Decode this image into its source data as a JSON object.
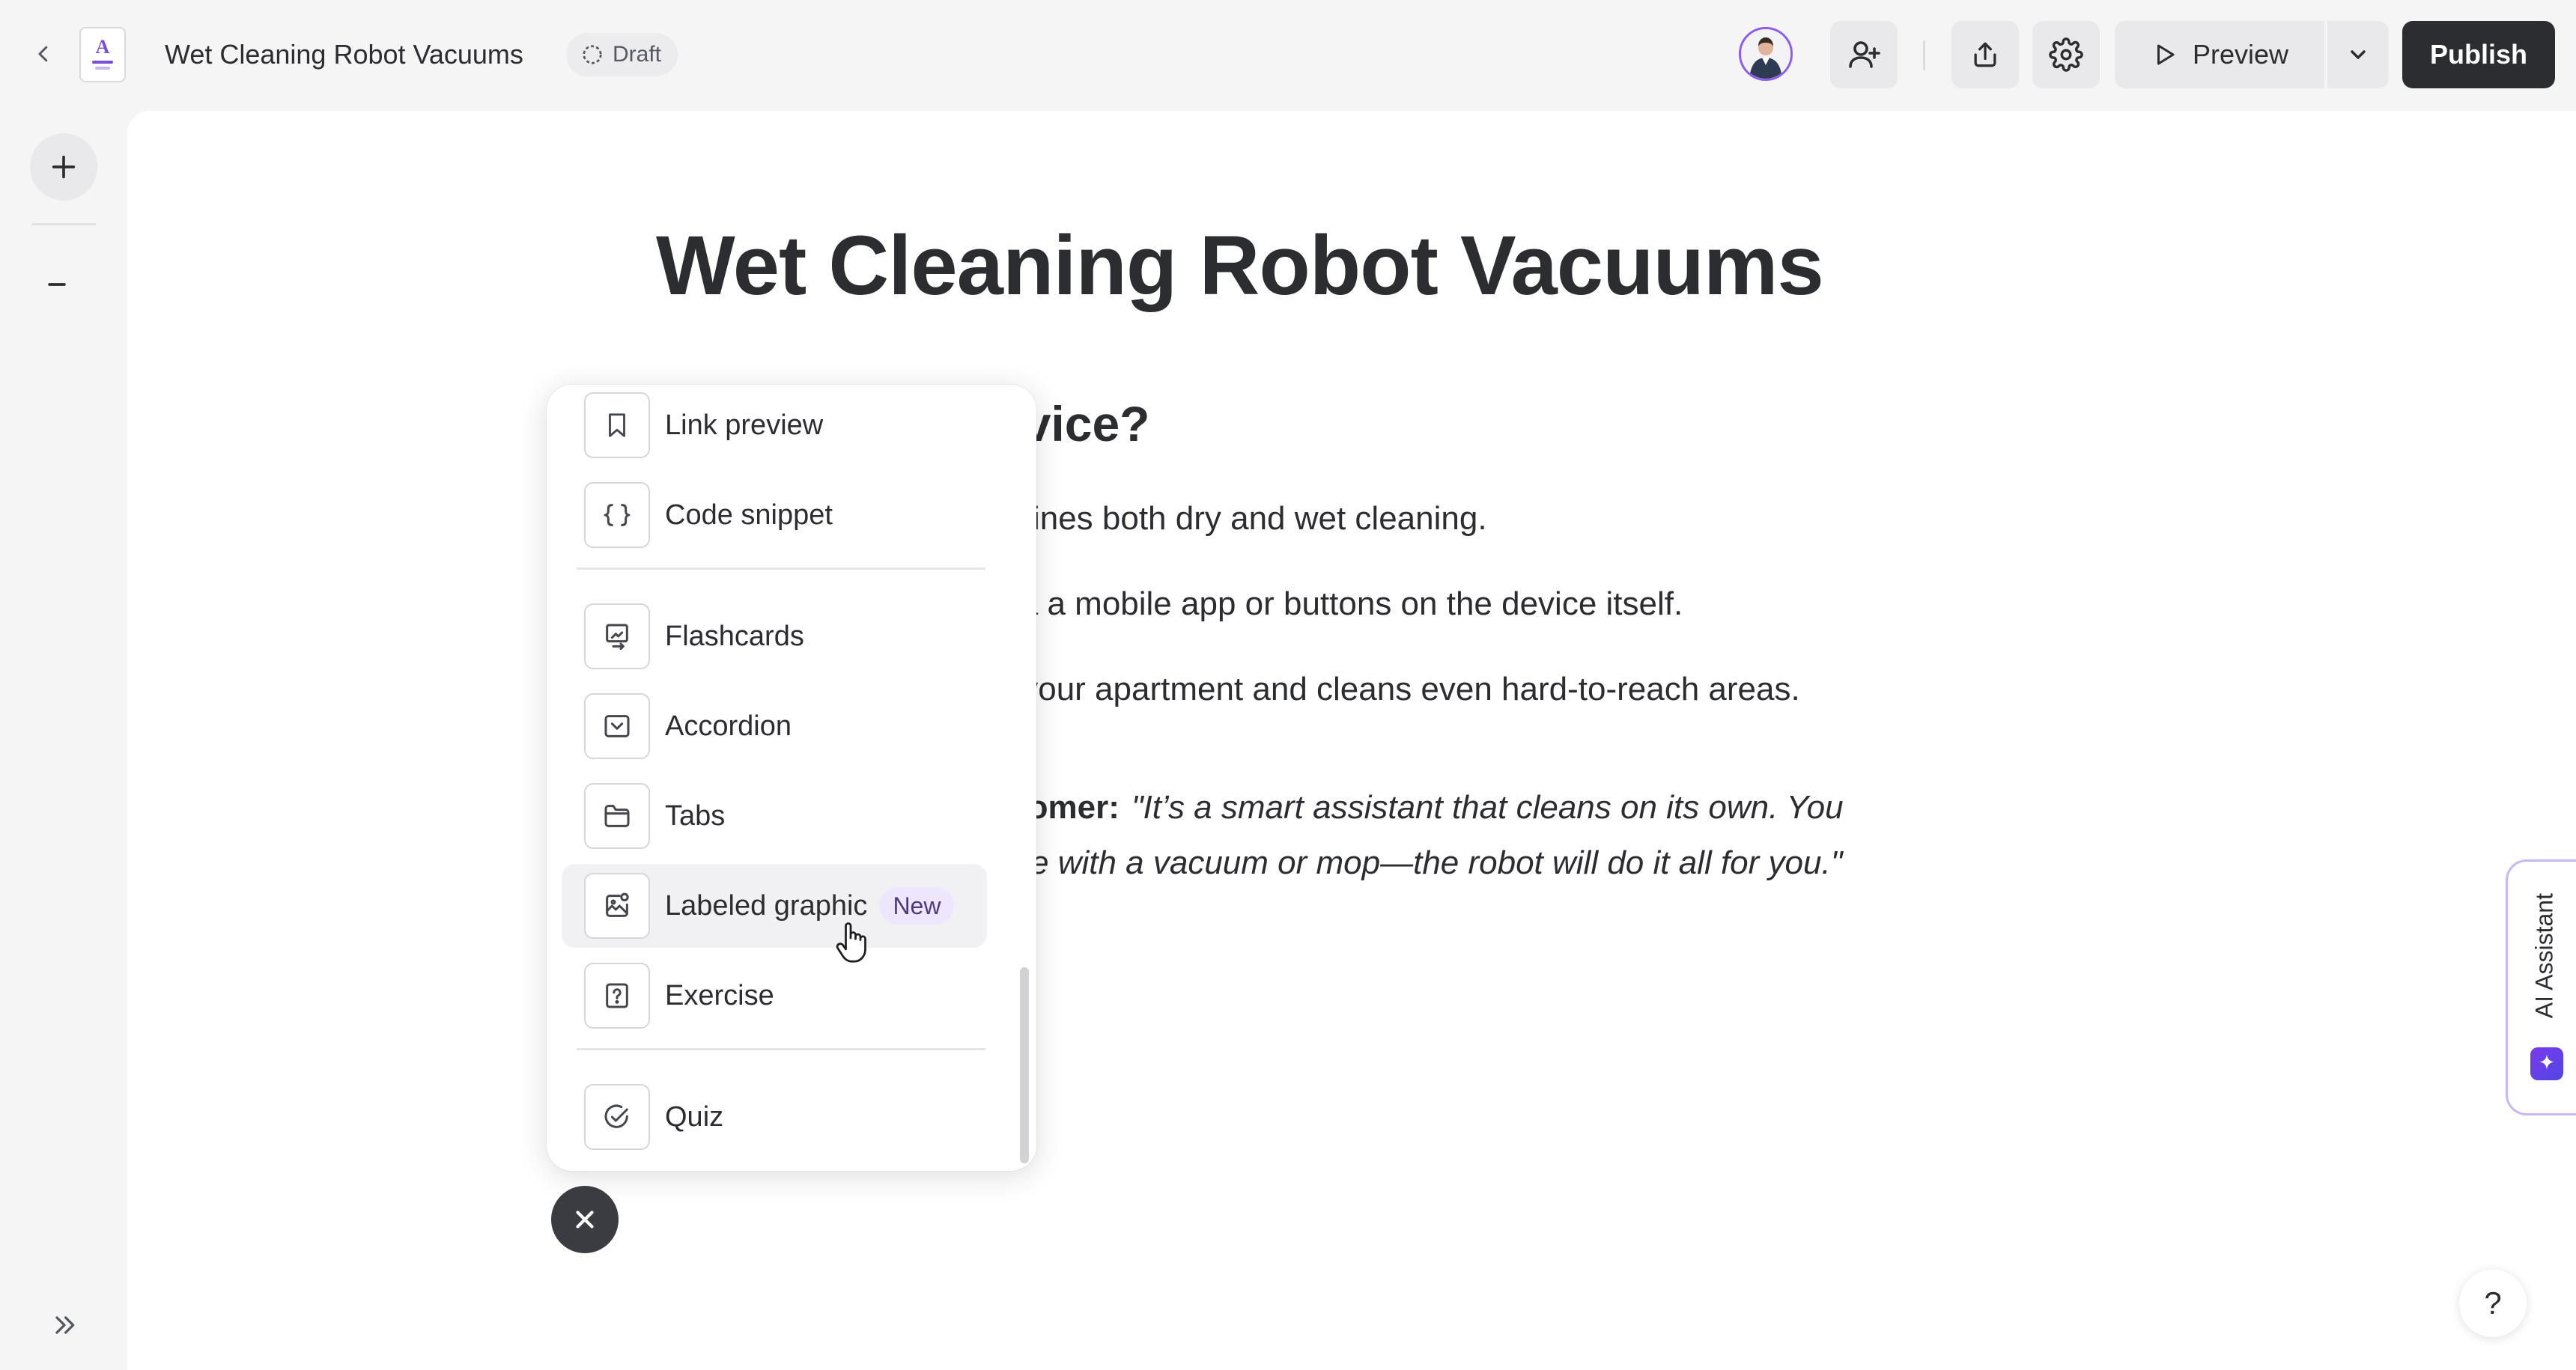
{
  "header": {
    "document_title": "Wet Cleaning Robot Vacuums",
    "status_label": "Draft",
    "preview_label": "Preview",
    "publish_label": "Publish",
    "doc_icon_letter": "A"
  },
  "content": {
    "title": "Wet Cleaning Robot Vacuums",
    "heading": "evice?",
    "paragraphs": [
      "nbines both dry and wet cleaning.",
      "via a mobile app or buttons on the device itself.",
      "s your apartment and cleans even hard-to-reach areas."
    ],
    "quote": {
      "label": "tomer:",
      "line1": "\"It’s a smart assistant that cleans on its own. You",
      "line2": "e with a vacuum or mop—the robot will do it all for you.\""
    }
  },
  "block_menu": {
    "items": [
      {
        "label": "Link preview",
        "icon": "bookmark-icon"
      },
      {
        "label": "Code snippet",
        "icon": "braces-icon"
      },
      {
        "label": "Flashcards",
        "icon": "flashcards-icon"
      },
      {
        "label": "Accordion",
        "icon": "accordion-icon"
      },
      {
        "label": "Tabs",
        "icon": "folder-tabs-icon"
      },
      {
        "label": "Labeled graphic",
        "icon": "labeled-image-icon",
        "badge": "New",
        "hovered": true
      },
      {
        "label": "Exercise",
        "icon": "question-box-icon"
      },
      {
        "label": "Quiz",
        "icon": "check-circle-icon"
      }
    ]
  },
  "ai_assistant": {
    "label": "AI Assistant"
  },
  "help": {
    "label": "?"
  },
  "colors": {
    "accent": "#8b5cf6",
    "publish_bg": "#2b2d31",
    "badge_bg": "#ede6fd"
  }
}
